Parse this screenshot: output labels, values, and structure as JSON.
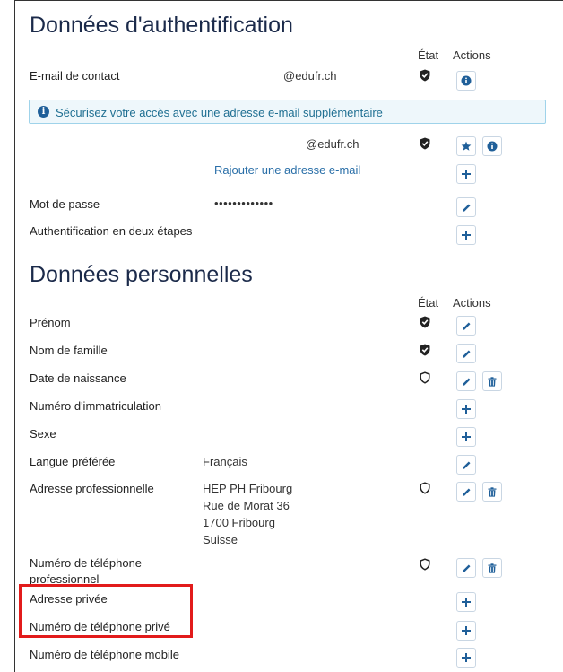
{
  "auth": {
    "title": "Données d'authentification",
    "col_state": "État",
    "col_actions": "Actions",
    "email_label": "E-mail de contact",
    "email_value": "@edufr.ch",
    "alert_text": "Sécurisez votre accès avec une adresse e-mail supplémentaire",
    "email2_value": "@edufr.ch",
    "add_email_link": "Rajouter une adresse e-mail",
    "password_label": "Mot de passe",
    "password_value": "•••••••••••••",
    "twofa_label": "Authentification en deux étapes"
  },
  "personal": {
    "title": "Données personnelles",
    "col_state": "État",
    "col_actions": "Actions",
    "first_name": "Prénom",
    "last_name": "Nom de famille",
    "birth_date": "Date de naissance",
    "matriculation": "Numéro d'immatriculation",
    "sex": "Sexe",
    "lang_label": "Langue préférée",
    "lang_value": "Français",
    "work_address_label": "Adresse professionnelle",
    "work_address_lines": [
      "HEP PH Fribourg",
      "Rue de Morat 36",
      "1700 Fribourg",
      "Suisse"
    ],
    "work_phone_line1": "Numéro de téléphone",
    "work_phone_line2": "professionnel",
    "private_address": "Adresse privée",
    "private_phone": "Numéro de téléphone privé",
    "mobile_phone": "Numéro de téléphone mobile"
  },
  "colors": {
    "accent": "#1f5f99",
    "highlight": "#e21b1b",
    "alert_bg": "#eef7fb",
    "link": "#2a6fa8"
  }
}
